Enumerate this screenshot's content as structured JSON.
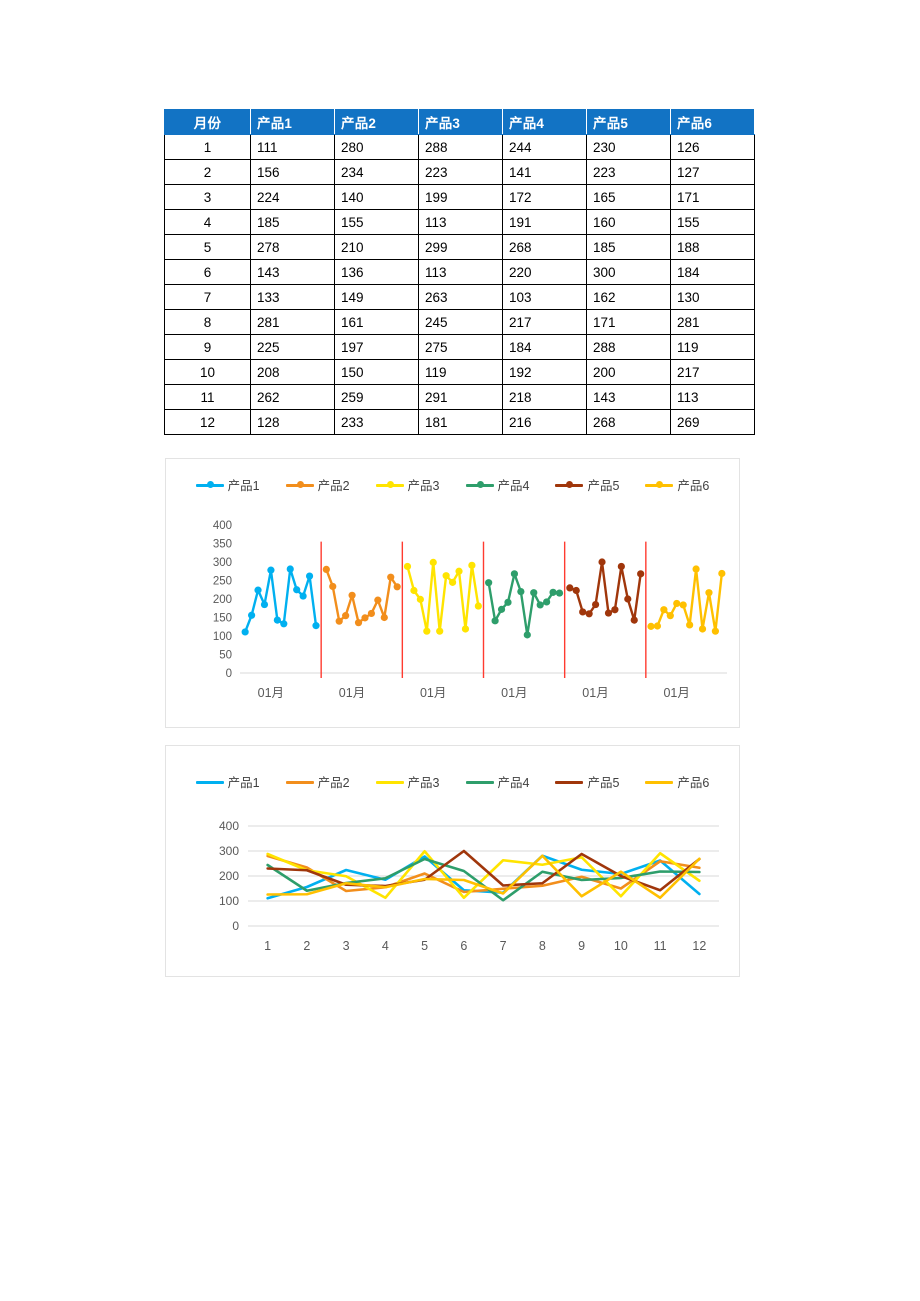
{
  "table": {
    "headers": [
      "月份",
      "产品1",
      "产品2",
      "产品3",
      "产品4",
      "产品5",
      "产品6"
    ],
    "header_bg": "#1273C4",
    "header_color": "#FFFFFF",
    "rows": [
      [
        "1",
        "111",
        "280",
        "288",
        "244",
        "230",
        "126"
      ],
      [
        "2",
        "156",
        "234",
        "223",
        "141",
        "223",
        "127"
      ],
      [
        "3",
        "224",
        "140",
        "199",
        "172",
        "165",
        "171"
      ],
      [
        "4",
        "185",
        "155",
        "113",
        "191",
        "160",
        "155"
      ],
      [
        "5",
        "278",
        "210",
        "299",
        "268",
        "185",
        "188"
      ],
      [
        "6",
        "143",
        "136",
        "113",
        "220",
        "300",
        "184"
      ],
      [
        "7",
        "133",
        "149",
        "263",
        "103",
        "162",
        "130"
      ],
      [
        "8",
        "281",
        "161",
        "245",
        "217",
        "171",
        "281"
      ],
      [
        "9",
        "225",
        "197",
        "275",
        "184",
        "288",
        "119"
      ],
      [
        "10",
        "208",
        "150",
        "119",
        "192",
        "200",
        "217"
      ],
      [
        "11",
        "262",
        "259",
        "291",
        "218",
        "143",
        "113"
      ],
      [
        "12",
        "128",
        "233",
        "181",
        "216",
        "268",
        "269"
      ]
    ]
  },
  "series_colors": [
    "#00B0F0",
    "#F28E1C",
    "#FFE400",
    "#2E9E6B",
    "#A0360B",
    "#FFC000"
  ],
  "chart_data": [
    {
      "id": "panel-chart",
      "type": "line",
      "title": "",
      "variant": "panel",
      "marker": "circle",
      "separator_color": "#FF3B30",
      "separator_count": 5,
      "categories": [
        1,
        2,
        3,
        4,
        5,
        6,
        7,
        8,
        9,
        10,
        11,
        12
      ],
      "xlabel": "",
      "ylabel": "",
      "xtick_labels": [
        "01月",
        "01月",
        "01月",
        "01月",
        "01月",
        "01月"
      ],
      "ytick_labels": [
        "0",
        "50",
        "100",
        "150",
        "200",
        "250",
        "300",
        "350",
        "400"
      ],
      "ylim": [
        0,
        400
      ],
      "ystep": 50,
      "grid": false,
      "legend_position": "top",
      "series": [
        {
          "name": "产品1",
          "color": "#00B0F0",
          "values": [
            111,
            156,
            224,
            185,
            278,
            143,
            133,
            281,
            225,
            208,
            262,
            128
          ]
        },
        {
          "name": "产品2",
          "color": "#F28E1C",
          "values": [
            280,
            234,
            140,
            155,
            210,
            136,
            149,
            161,
            197,
            150,
            259,
            233
          ]
        },
        {
          "name": "产品3",
          "color": "#FFE400",
          "values": [
            288,
            223,
            199,
            113,
            299,
            113,
            263,
            245,
            275,
            119,
            291,
            181
          ]
        },
        {
          "name": "产品4",
          "color": "#2E9E6B",
          "values": [
            244,
            141,
            172,
            191,
            268,
            220,
            103,
            217,
            184,
            192,
            218,
            216
          ]
        },
        {
          "name": "产品5",
          "color": "#A0360B",
          "values": [
            230,
            223,
            165,
            160,
            185,
            300,
            162,
            171,
            288,
            200,
            143,
            268
          ]
        },
        {
          "name": "产品6",
          "color": "#FFC000",
          "values": [
            126,
            127,
            171,
            155,
            188,
            184,
            130,
            281,
            119,
            217,
            113,
            269
          ]
        }
      ]
    },
    {
      "id": "overlay-chart",
      "type": "line",
      "title": "",
      "variant": "overlay",
      "marker": "none",
      "categories": [
        1,
        2,
        3,
        4,
        5,
        6,
        7,
        8,
        9,
        10,
        11,
        12
      ],
      "xlabel": "",
      "ylabel": "",
      "xtick_labels": [
        "1",
        "2",
        "3",
        "4",
        "5",
        "6",
        "7",
        "8",
        "9",
        "10",
        "11",
        "12"
      ],
      "ytick_labels": [
        "0",
        "100",
        "200",
        "300",
        "400"
      ],
      "ylim": [
        0,
        400
      ],
      "ystep": 100,
      "grid": true,
      "legend_position": "top",
      "series": [
        {
          "name": "产品1",
          "color": "#00B0F0",
          "values": [
            111,
            156,
            224,
            185,
            278,
            143,
            133,
            281,
            225,
            208,
            262,
            128
          ]
        },
        {
          "name": "产品2",
          "color": "#F28E1C",
          "values": [
            280,
            234,
            140,
            155,
            210,
            136,
            149,
            161,
            197,
            150,
            259,
            233
          ]
        },
        {
          "name": "产品3",
          "color": "#FFE400",
          "values": [
            288,
            223,
            199,
            113,
            299,
            113,
            263,
            245,
            275,
            119,
            291,
            181
          ]
        },
        {
          "name": "产品4",
          "color": "#2E9E6B",
          "values": [
            244,
            141,
            172,
            191,
            268,
            220,
            103,
            217,
            184,
            192,
            218,
            216
          ]
        },
        {
          "name": "产品5",
          "color": "#A0360B",
          "values": [
            230,
            223,
            165,
            160,
            185,
            300,
            162,
            171,
            288,
            200,
            143,
            268
          ]
        },
        {
          "name": "产品6",
          "color": "#FFC000",
          "values": [
            126,
            127,
            171,
            155,
            188,
            184,
            130,
            281,
            119,
            217,
            113,
            269
          ]
        }
      ]
    }
  ]
}
